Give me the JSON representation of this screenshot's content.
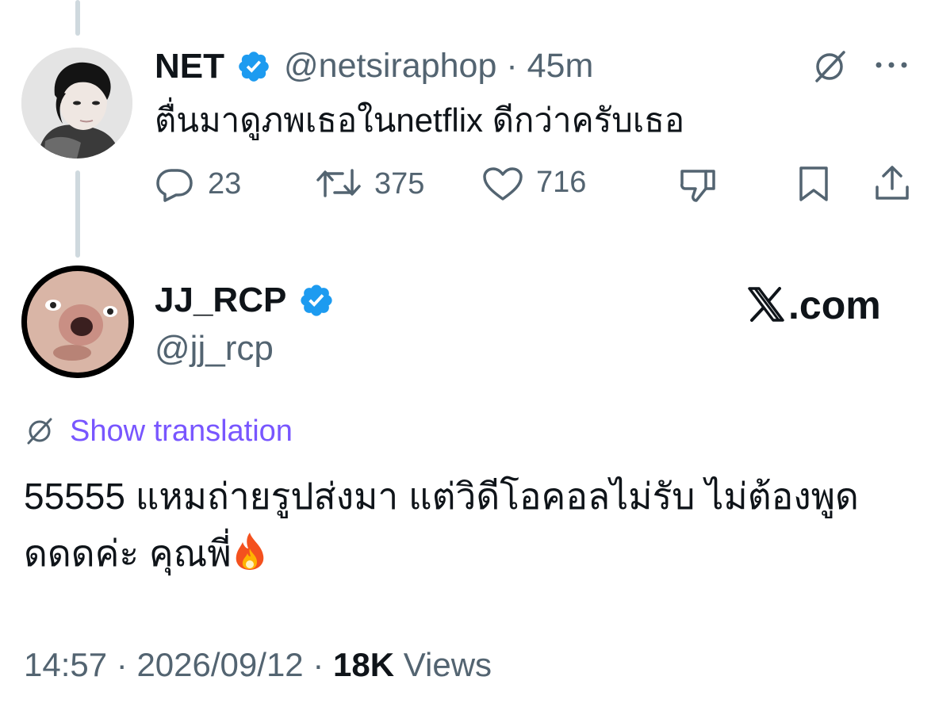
{
  "parent_tweet": {
    "display_name": "NET",
    "handle": "@netsiraphop",
    "separator": "·",
    "time_ago": "45m",
    "text": "ตื่นมาดูภพเธอในnetflix ดีกว่าครับเธอ",
    "actions": {
      "reply_count": "23",
      "retweet_count": "375",
      "like_count": "716"
    },
    "icons": [
      "grok-icon",
      "more-icon",
      "reply-icon",
      "retweet-icon",
      "like-icon",
      "dislike-icon",
      "bookmark-icon",
      "share-icon"
    ]
  },
  "reply_tweet": {
    "display_name": "JJ_RCP",
    "handle": "@jj_rcp",
    "show_translation": "Show translation",
    "text": "55555 แหมถ่ายรูปส่งมา แต่วิดีโอคอลไม่รับ ไม่ต้องพูดดดดค่ะ คุณพี่",
    "emoji": "fire-emoji",
    "time": "14:57",
    "date": "2026/09/12",
    "views_count": "18K",
    "views_label": "Views",
    "separator": "·"
  },
  "watermark": {
    "logo": "x-logo",
    "text": ".com"
  },
  "colors": {
    "text_primary": "#0f1419",
    "text_secondary": "#536471",
    "verified_blue": "#1d9bf0",
    "translation_link": "#7856ff",
    "thread_line": "#cfd9de"
  }
}
